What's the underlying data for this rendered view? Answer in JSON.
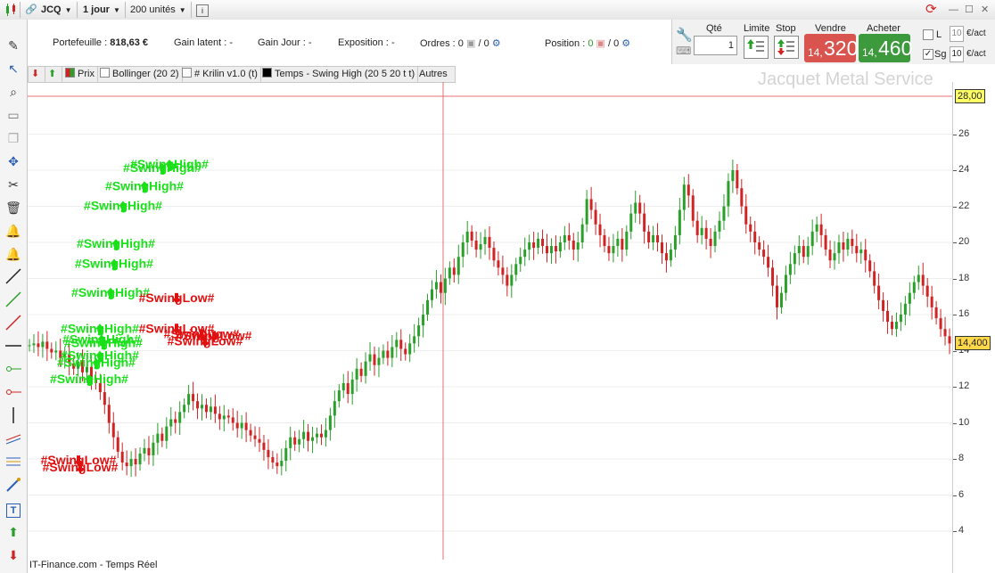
{
  "toolbar": {
    "symbol": "JCQ",
    "interval": "1 jour",
    "units": "200 unités",
    "info_icon": "info-icon"
  },
  "account": {
    "portefeuille_label": "Portefeuille :",
    "portefeuille_value": "818,63 €",
    "gain_latent_label": "Gain latent :",
    "gain_latent_value": "-",
    "gain_jour_label": "Gain Jour :",
    "gain_jour_value": "-",
    "exposition_label": "Exposition :",
    "exposition_value": "-",
    "ordres_label": "Ordres :",
    "ordres_a": "0",
    "ordres_b": "/ 0",
    "position_label": "Position :",
    "position_a": "0",
    "position_b": "/ 0"
  },
  "order_panel": {
    "qte_label": "Qté",
    "qte_value": "1",
    "limite_label": "Limite",
    "stop_label": "Stop",
    "vendre_label": "Vendre",
    "acheter_label": "Acheter",
    "sell_small": "14,",
    "sell_big": "320",
    "buy_small": "14,",
    "buy_big": "460",
    "l_label": "L",
    "sg_label": "Sg",
    "l_value": "10",
    "sg_value": "10",
    "unit_l": "€/act",
    "unit_sg": "€/act",
    "sell_color": "#d9534f",
    "buy_color": "#3c9a3c"
  },
  "legend": {
    "prix": "Prix",
    "bollinger": "Bollinger (20 2)",
    "krilin": "# Krilin v1.0 (t)",
    "temps": "Temps - Swing High (20 5 20 t t)",
    "autres": "Autres"
  },
  "watermark": "Jacquet Metal Service",
  "footer": "IT-Finance.com - Temps Réel",
  "colors": {
    "up": "#2aa02a",
    "down": "#d02424",
    "swing_high": "#19e019",
    "swing_low": "#e01010",
    "guide": "#e07070"
  },
  "chart_data": {
    "type": "candlestick",
    "title": "Jacquet Metal Service",
    "ylim": [
      2,
      29
    ],
    "yticks": [
      4,
      6,
      8,
      10,
      12,
      14,
      16,
      18,
      20,
      22,
      24,
      26
    ],
    "top_level": "28,00",
    "last_price": "14,400",
    "close_series": [
      14.3,
      14.4,
      14.2,
      14.5,
      14.1,
      13.9,
      14.0,
      13.6,
      13.8,
      13.3,
      13.0,
      13.4,
      12.8,
      13.1,
      12.5,
      12.2,
      11.7,
      11.0,
      10.0,
      9.2,
      8.4,
      7.8,
      7.6,
      8.0,
      7.7,
      8.3,
      8.6,
      8.2,
      8.9,
      9.4,
      9.0,
      9.8,
      10.2,
      10.0,
      10.6,
      11.0,
      11.6,
      11.2,
      10.8,
      11.0,
      10.6,
      10.9,
      10.5,
      10.2,
      10.4,
      10.3,
      10.0,
      9.7,
      10.0,
      9.6,
      9.3,
      9.1,
      8.9,
      8.5,
      8.1,
      7.8,
      7.6,
      7.9,
      8.6,
      9.2,
      8.8,
      9.1,
      9.5,
      9.0,
      9.2,
      9.4,
      9.2,
      9.6,
      10.4,
      11.2,
      11.8,
      12.2,
      11.6,
      12.4,
      13.0,
      12.6,
      13.4,
      13.8,
      13.2,
      13.6,
      14.0,
      13.6,
      14.2,
      14.6,
      14.1,
      13.8,
      14.4,
      14.8,
      15.4,
      16.0,
      16.8,
      17.4,
      17.8,
      17.2,
      18.0,
      18.6,
      18.2,
      19.2,
      20.0,
      20.6,
      20.1,
      19.6,
      19.9,
      20.3,
      19.7,
      19.0,
      18.6,
      18.2,
      17.6,
      18.2,
      18.8,
      19.2,
      19.6,
      20.0,
      19.7,
      20.2,
      19.8,
      19.4,
      19.8,
      19.5,
      20.0,
      20.4,
      20.1,
      19.6,
      20.0,
      21.0,
      22.4,
      21.8,
      21.0,
      20.4,
      19.8,
      19.4,
      19.8,
      20.2,
      19.6,
      20.6,
      21.6,
      22.2,
      21.6,
      20.6,
      20.0,
      20.4,
      20.0,
      19.4,
      19.0,
      19.6,
      20.4,
      21.8,
      23.2,
      22.6,
      21.2,
      20.4,
      20.8,
      20.2,
      19.8,
      20.6,
      21.2,
      22.0,
      23.4,
      24.0,
      23.0,
      22.0,
      21.0,
      20.6,
      20.0,
      19.6,
      19.2,
      18.6,
      17.6,
      16.4,
      17.2,
      18.2,
      18.8,
      19.4,
      19.8,
      19.2,
      19.8,
      20.6,
      21.0,
      20.4,
      19.6,
      19.0,
      19.4,
      20.0,
      19.6,
      20.2,
      19.8,
      19.4,
      19.6,
      19.0,
      18.4,
      17.6,
      16.8,
      16.2,
      15.6,
      15.2,
      15.6,
      16.0,
      16.6,
      17.2,
      17.8,
      18.2,
      17.6,
      17.0,
      16.4,
      15.8,
      15.2,
      14.8,
      14.4
    ],
    "swing_high": [
      [
        2,
        15.0
      ],
      [
        4,
        14.2
      ],
      [
        5,
        13.5
      ],
      [
        6,
        13.1
      ],
      [
        7,
        12.2
      ],
      [
        8,
        17.0
      ],
      [
        9,
        18.6
      ],
      [
        10,
        19.7
      ],
      [
        11,
        14.4
      ],
      [
        12,
        21.8
      ],
      [
        13,
        22.9
      ],
      [
        14,
        23.9
      ],
      [
        15,
        24.1
      ]
    ],
    "swing_low": [
      [
        18,
        7.7
      ],
      [
        19,
        7.3
      ],
      [
        30,
        16.7
      ],
      [
        31,
        15.0
      ],
      [
        32,
        14.7
      ],
      [
        33,
        14.3
      ],
      [
        34,
        14.6
      ]
    ],
    "swing_high_text": "#SwingHigh#",
    "swing_low_text": "#SwingLow#"
  }
}
